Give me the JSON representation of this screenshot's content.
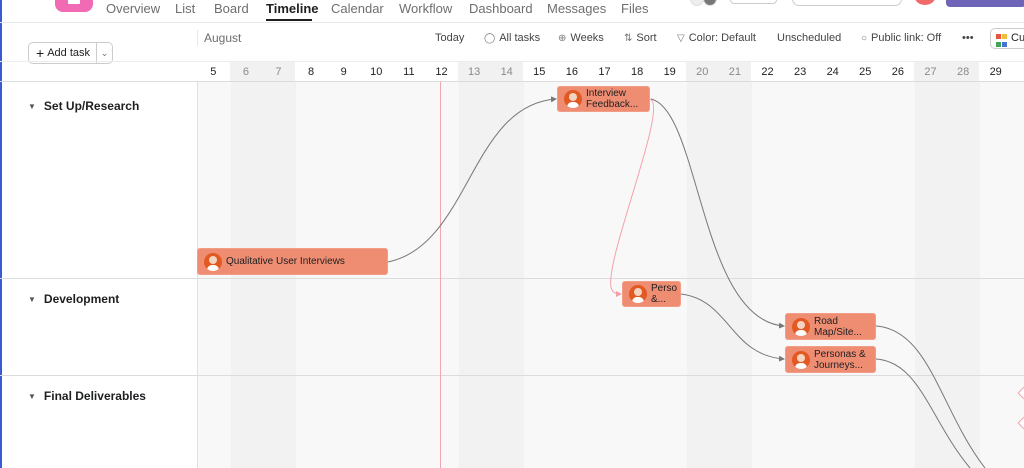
{
  "nav": {
    "tabs": [
      {
        "label": "Overview"
      },
      {
        "label": "List"
      },
      {
        "label": "Board"
      },
      {
        "label": "Timeline",
        "active": true
      },
      {
        "label": "Calendar"
      },
      {
        "label": "Workflow"
      },
      {
        "label": "Dashboard"
      },
      {
        "label": "Messages"
      },
      {
        "label": "Files"
      }
    ]
  },
  "toolbar": {
    "add_task": "Add task",
    "month": "August",
    "today": "Today",
    "all_tasks": "All tasks",
    "weeks": "Weeks",
    "sort": "Sort",
    "color": "Color: Default",
    "unscheduled": "Unscheduled",
    "public_link": "Public link: Off",
    "more": "•••",
    "customize": "Cu"
  },
  "days": [
    "5",
    "6",
    "7",
    "8",
    "9",
    "10",
    "11",
    "12",
    "13",
    "14",
    "15",
    "16",
    "17",
    "18",
    "19",
    "20",
    "21",
    "22",
    "23",
    "24",
    "25",
    "26",
    "27",
    "28",
    "29",
    "3"
  ],
  "weekend_days": [
    "6",
    "7",
    "13",
    "14",
    "20",
    "21",
    "27",
    "28"
  ],
  "today": "12",
  "sections": [
    {
      "name": "Set Up/Research"
    },
    {
      "name": "Development"
    },
    {
      "name": "Final Deliverables"
    }
  ],
  "tasks": [
    {
      "name": "Qualitative User Interviews"
    },
    {
      "name": "Interview Feedback..."
    },
    {
      "name": "Perso &..."
    },
    {
      "name": "Road Map/Site..."
    },
    {
      "name": "Personas & Journeys..."
    }
  ],
  "colors": {
    "task": "#ef8d73",
    "today_line": "#f0a6b0",
    "accent": "#6e64b8",
    "logo": "#f06ab4"
  }
}
